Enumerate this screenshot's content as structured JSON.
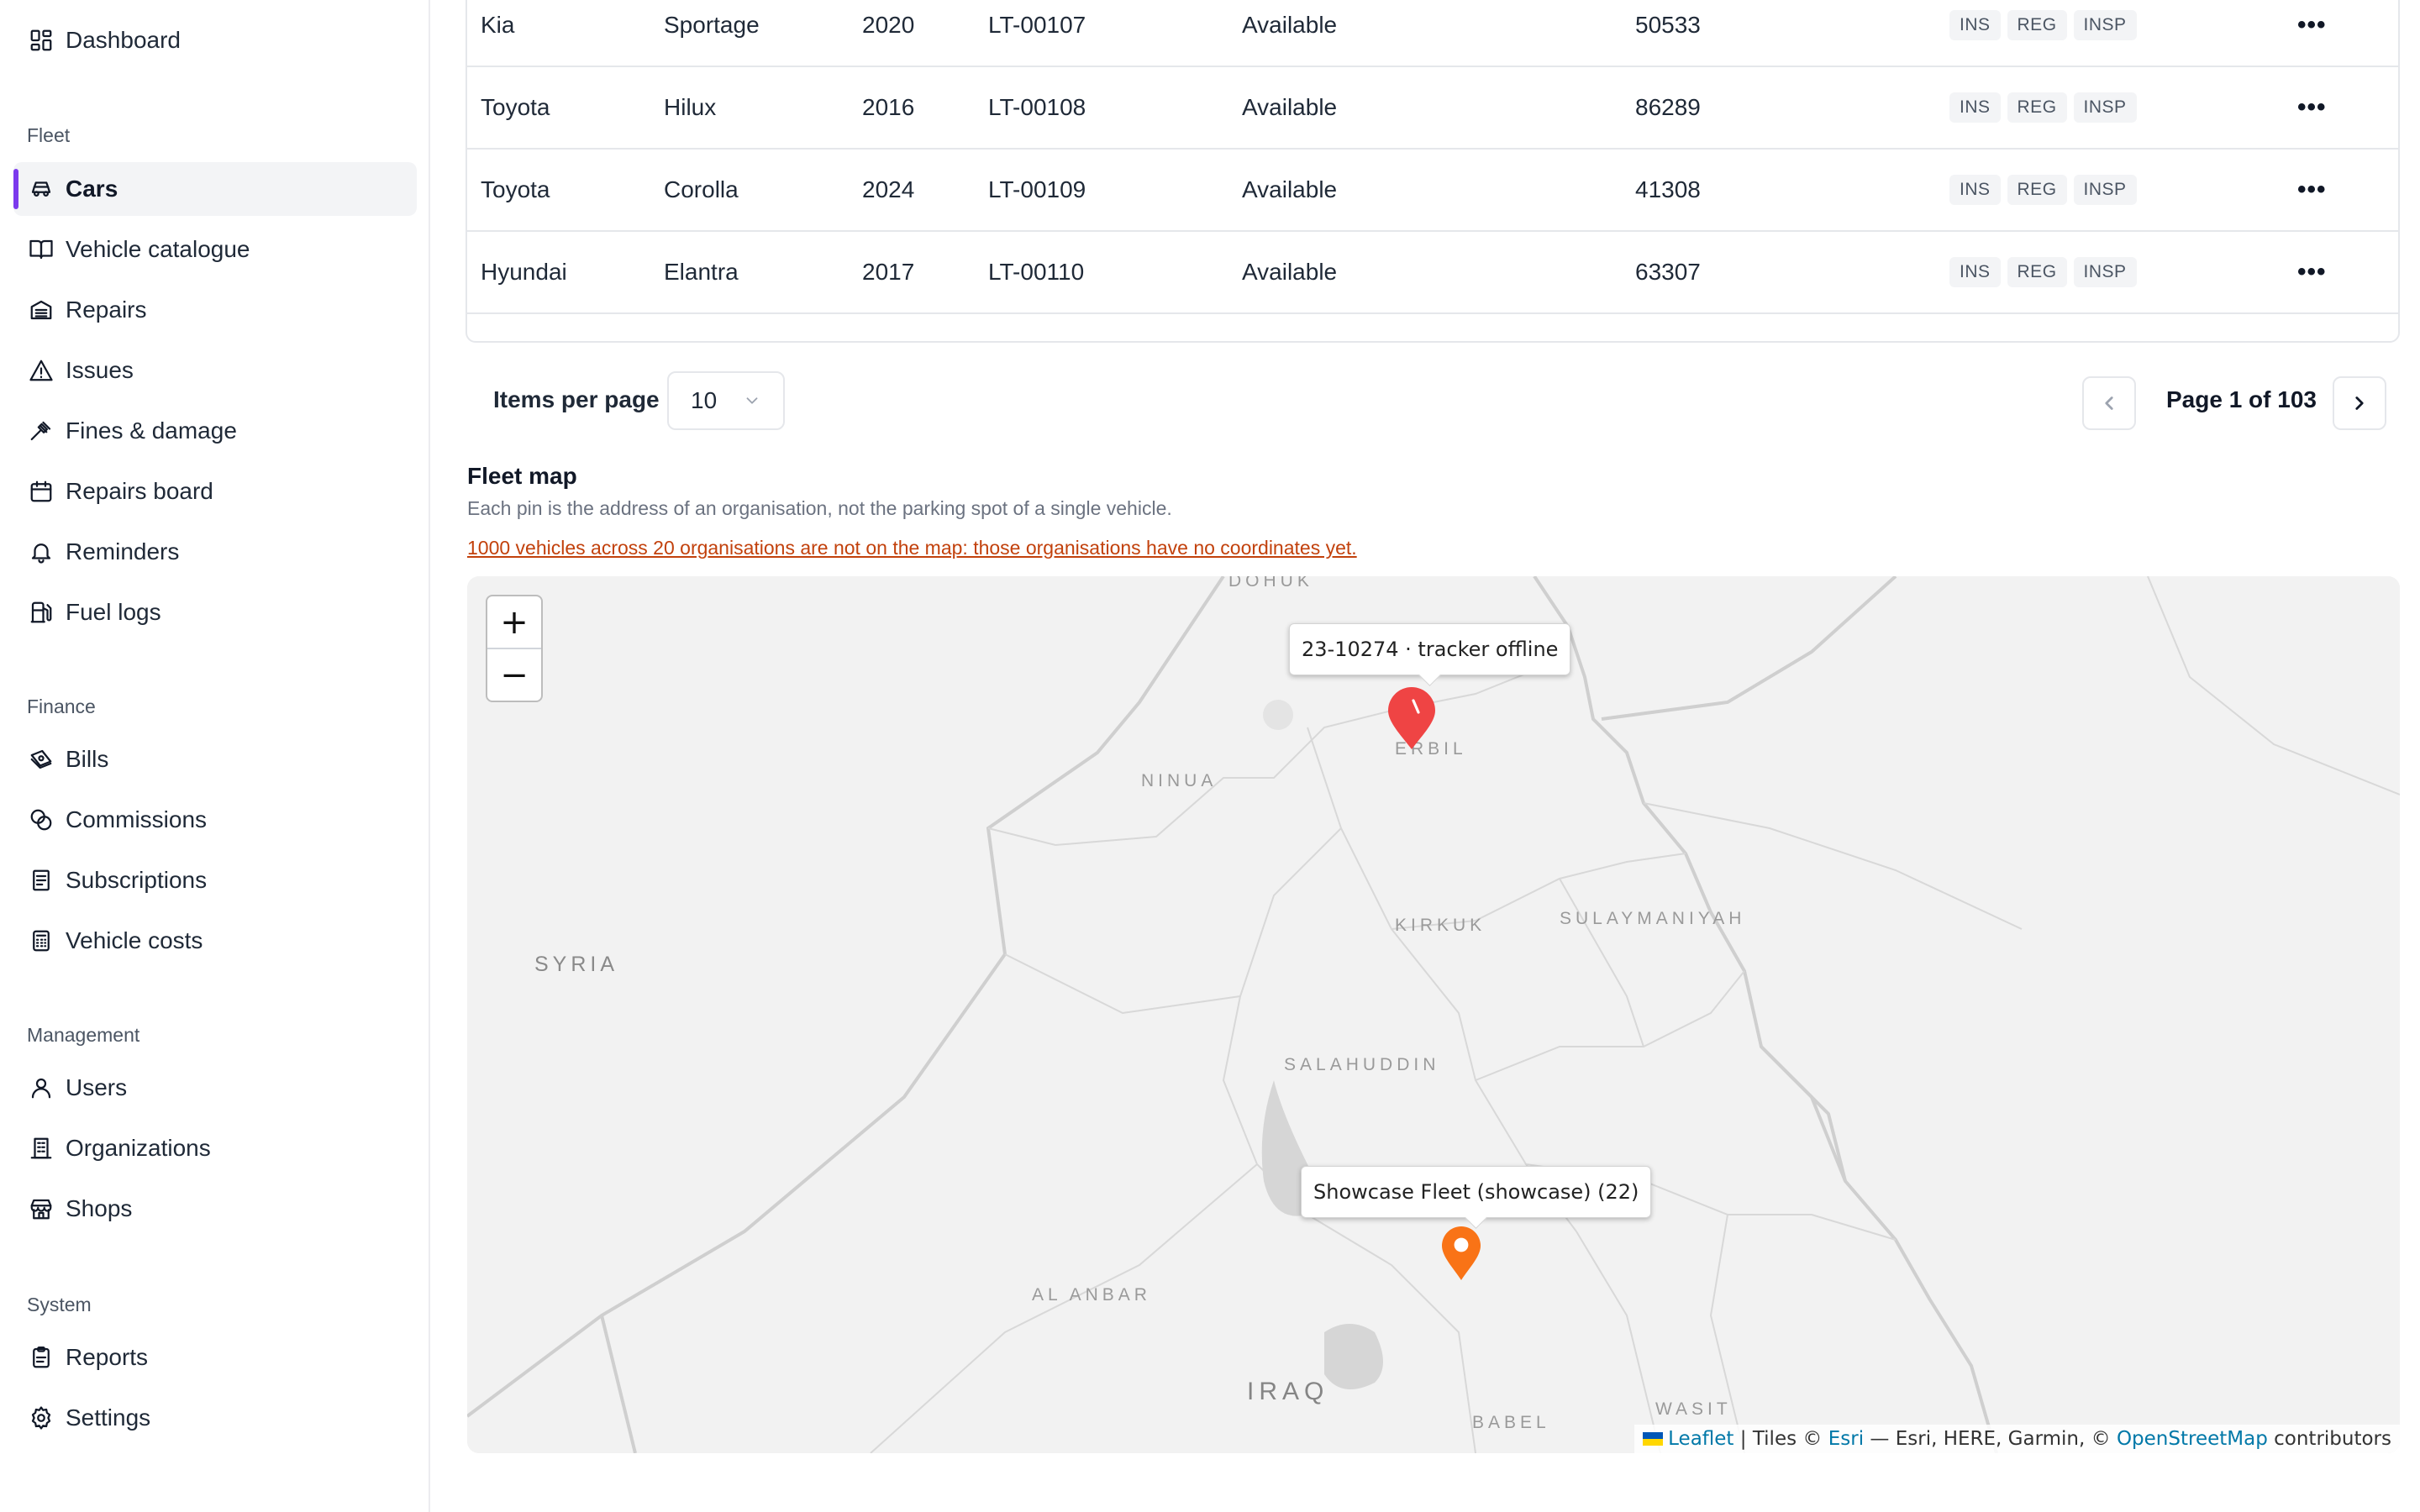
{
  "sidebar": {
    "dashboard": "Dashboard",
    "sections": {
      "fleet": "Fleet",
      "finance": "Finance",
      "management": "Management",
      "system": "System"
    },
    "fleet_items": [
      "Cars",
      "Vehicle catalogue",
      "Repairs",
      "Issues",
      "Fines & damage",
      "Repairs board",
      "Reminders",
      "Fuel logs"
    ],
    "finance_items": [
      "Bills",
      "Commissions",
      "Subscriptions",
      "Vehicle costs"
    ],
    "management_items": [
      "Users",
      "Organizations",
      "Shops"
    ],
    "system_items": [
      "Reports",
      "Settings"
    ],
    "active_item": "Cars",
    "accent_color": "#7c3aed"
  },
  "table": {
    "rows": [
      {
        "make": "Kia",
        "model": "Sportage",
        "year": "2020",
        "plate": "LT-00107",
        "status": "Available",
        "mileage": "50533",
        "tags": [
          "INS",
          "REG",
          "INSP"
        ]
      },
      {
        "make": "Toyota",
        "model": "Hilux",
        "year": "2016",
        "plate": "LT-00108",
        "status": "Available",
        "mileage": "86289",
        "tags": [
          "INS",
          "REG",
          "INSP"
        ]
      },
      {
        "make": "Toyota",
        "model": "Corolla",
        "year": "2024",
        "plate": "LT-00109",
        "status": "Available",
        "mileage": "41308",
        "tags": [
          "INS",
          "REG",
          "INSP"
        ]
      },
      {
        "make": "Hyundai",
        "model": "Elantra",
        "year": "2017",
        "plate": "LT-00110",
        "status": "Available",
        "mileage": "63307",
        "tags": [
          "INS",
          "REG",
          "INSP"
        ]
      }
    ],
    "row_action_icon": "more-horizontal-icon"
  },
  "pagination": {
    "items_per_page_label": "Items per page",
    "items_per_page_value": "10",
    "page_text": "Page 1 of 103"
  },
  "fleet_map": {
    "title": "Fleet map",
    "subtitle": "Each pin is the address of an organisation, not the parking spot of a single vehicle.",
    "warning": "1000 vehicles across 20 organisations are not on the map: those organisations have no coordinates yet.",
    "warning_color": "#c2410c",
    "zoom_in": "+",
    "zoom_out": "−",
    "labels": {
      "dohuk": "DOHUK",
      "ninua": "NINUA",
      "erbil": "ERBIL",
      "kirkuk": "KIRKUK",
      "sulaymaniyah": "SULAYMANIYAH",
      "syria": "SYRIA",
      "salahuddin": "SALAHUDDIN",
      "al_anbar": "AL ANBAR",
      "iraq": "IRAQ",
      "babel": "BABEL",
      "wasit": "WASIT"
    },
    "markers": [
      {
        "tooltip": "23-10274 · tracker offline",
        "color": "#ef4444"
      },
      {
        "tooltip": "Showcase Fleet (showcase) (22)",
        "color": "#f97316"
      }
    ],
    "attribution": {
      "leaflet": "Leaflet",
      "tiles_prefix": "| Tiles ©",
      "esri": "Esri",
      "middle": "— Esri, HERE, Garmin, ©",
      "osm": "OpenStreetMap",
      "suffix": "contributors"
    }
  }
}
